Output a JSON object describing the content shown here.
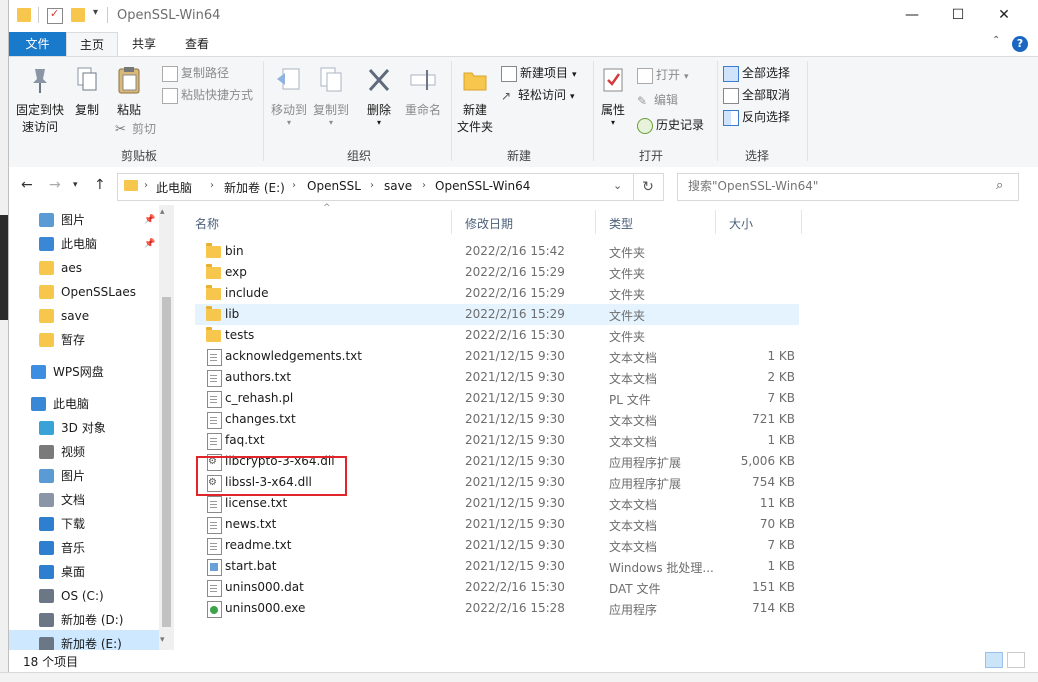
{
  "window": {
    "title": "OpenSSL-Win64",
    "controls": {
      "minimize": "—",
      "maximize": "☐",
      "close": "✕"
    }
  },
  "ribbon": {
    "tabs": [
      {
        "label": "文件",
        "active": false
      },
      {
        "label": "主页",
        "active": true
      },
      {
        "label": "共享",
        "active": false
      },
      {
        "label": "查看",
        "active": false
      }
    ],
    "help": "?",
    "clipboard": {
      "label": "剪贴板",
      "pin": "固定到快速访问",
      "pin_line1": "固定到快",
      "pin_line2": "速访问",
      "copy": "复制",
      "paste": "粘贴",
      "copy_path": "复制路径",
      "paste_shortcut": "粘贴快捷方式",
      "cut": "剪切"
    },
    "organize": {
      "label": "组织",
      "move_to": "移动到",
      "copy_to": "复制到",
      "delete": "删除",
      "rename": "重命名"
    },
    "new": {
      "label": "新建",
      "new_folder_line1": "新建",
      "new_folder_line2": "文件夹",
      "new_item": "新建项目",
      "easy_access": "轻松访问"
    },
    "open": {
      "label": "打开",
      "properties": "属性",
      "open": "打开",
      "edit": "编辑",
      "history": "历史记录"
    },
    "select": {
      "label": "选择",
      "select_all": "全部选择",
      "select_none": "全部取消",
      "invert": "反向选择"
    }
  },
  "address": {
    "breadcrumbs": [
      "此电脑",
      "新加卷 (E:)",
      "OpenSSL",
      "save",
      "OpenSSL-Win64"
    ],
    "search_placeholder": "搜索\"OpenSSL-Win64\""
  },
  "nav": {
    "items": [
      {
        "label": "图片",
        "icon": "pictures-icon",
        "pinned": true
      },
      {
        "label": "此电脑",
        "icon": "this-pc-icon",
        "pinned": true
      },
      {
        "label": "aes",
        "icon": "folder-icon",
        "pinned": false
      },
      {
        "label": "OpenSSLaes",
        "icon": "folder-icon",
        "pinned": false
      },
      {
        "label": "save",
        "icon": "folder-icon",
        "pinned": false
      },
      {
        "label": "暂存",
        "icon": "folder-icon",
        "pinned": false
      },
      {
        "label": "WPS网盘",
        "icon": "cloud-icon",
        "pinned": false
      },
      {
        "label": "此电脑",
        "icon": "this-pc-icon",
        "pinned": false
      },
      {
        "label": "3D 对象",
        "icon": "3d-objects-icon",
        "pinned": false
      },
      {
        "label": "视频",
        "icon": "videos-icon",
        "pinned": false
      },
      {
        "label": "图片",
        "icon": "pictures-icon",
        "pinned": false
      },
      {
        "label": "文档",
        "icon": "documents-icon",
        "pinned": false
      },
      {
        "label": "下载",
        "icon": "downloads-icon",
        "pinned": false
      },
      {
        "label": "音乐",
        "icon": "music-icon",
        "pinned": false
      },
      {
        "label": "桌面",
        "icon": "desktop-icon",
        "pinned": false
      },
      {
        "label": "OS (C:)",
        "icon": "drive-icon",
        "pinned": false
      },
      {
        "label": "新加卷 (D:)",
        "icon": "drive-icon",
        "pinned": false
      },
      {
        "label": "新加卷 (E:)",
        "icon": "drive-icon",
        "pinned": false,
        "selected": true
      }
    ]
  },
  "columns": {
    "name": "名称",
    "date": "修改日期",
    "type": "类型",
    "size": "大小"
  },
  "files": [
    {
      "name": "bin",
      "date": "2022/2/16 15:42",
      "type": "文件夹",
      "size": "",
      "icon": "folder"
    },
    {
      "name": "exp",
      "date": "2022/2/16 15:29",
      "type": "文件夹",
      "size": "",
      "icon": "folder"
    },
    {
      "name": "include",
      "date": "2022/2/16 15:29",
      "type": "文件夹",
      "size": "",
      "icon": "folder"
    },
    {
      "name": "lib",
      "date": "2022/2/16 15:29",
      "type": "文件夹",
      "size": "",
      "icon": "folder",
      "hover": true
    },
    {
      "name": "tests",
      "date": "2022/2/16 15:30",
      "type": "文件夹",
      "size": "",
      "icon": "folder"
    },
    {
      "name": "acknowledgements.txt",
      "date": "2021/12/15 9:30",
      "type": "文本文档",
      "size": "1 KB",
      "icon": "doc"
    },
    {
      "name": "authors.txt",
      "date": "2021/12/15 9:30",
      "type": "文本文档",
      "size": "2 KB",
      "icon": "doc"
    },
    {
      "name": "c_rehash.pl",
      "date": "2021/12/15 9:30",
      "type": "PL 文件",
      "size": "7 KB",
      "icon": "doc"
    },
    {
      "name": "changes.txt",
      "date": "2021/12/15 9:30",
      "type": "文本文档",
      "size": "721 KB",
      "icon": "doc"
    },
    {
      "name": "faq.txt",
      "date": "2021/12/15 9:30",
      "type": "文本文档",
      "size": "1 KB",
      "icon": "doc"
    },
    {
      "name": "libcrypto-3-x64.dll",
      "date": "2021/12/15 9:30",
      "type": "应用程序扩展",
      "size": "5,006 KB",
      "icon": "dll"
    },
    {
      "name": "libssl-3-x64.dll",
      "date": "2021/12/15 9:30",
      "type": "应用程序扩展",
      "size": "754 KB",
      "icon": "dll"
    },
    {
      "name": "license.txt",
      "date": "2021/12/15 9:30",
      "type": "文本文档",
      "size": "11 KB",
      "icon": "doc"
    },
    {
      "name": "news.txt",
      "date": "2021/12/15 9:30",
      "type": "文本文档",
      "size": "70 KB",
      "icon": "doc"
    },
    {
      "name": "readme.txt",
      "date": "2021/12/15 9:30",
      "type": "文本文档",
      "size": "7 KB",
      "icon": "doc"
    },
    {
      "name": "start.bat",
      "date": "2021/12/15 9:30",
      "type": "Windows 批处理...",
      "size": "1 KB",
      "icon": "bat"
    },
    {
      "name": "unins000.dat",
      "date": "2022/2/16 15:30",
      "type": "DAT 文件",
      "size": "151 KB",
      "icon": "doc"
    },
    {
      "name": "unins000.exe",
      "date": "2022/2/16 15:28",
      "type": "应用程序",
      "size": "714 KB",
      "icon": "exe"
    }
  ],
  "status": {
    "count": "18 个项目"
  },
  "colors": {
    "accent": "#1979ca",
    "highlight": "#e0262b",
    "folder": "#f7c64c",
    "hover": "#e5f3ff"
  }
}
